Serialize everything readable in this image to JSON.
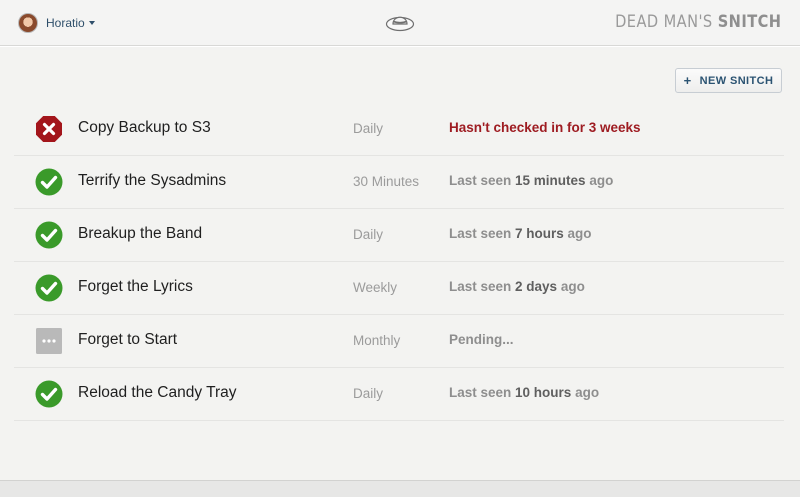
{
  "header": {
    "user_name": "Horatio",
    "brand_light": "DEAD MAN'S ",
    "brand_strong": "SNITCH"
  },
  "actions": {
    "new_snitch_plus": "+",
    "new_snitch_label": "NEW SNITCH"
  },
  "snitches": [
    {
      "name": "Copy Backup to S3",
      "interval": "Daily",
      "status": "failed",
      "seen_prefix": "Hasn't checked in for ",
      "seen_value": "3 weeks",
      "seen_suffix": ""
    },
    {
      "name": "Terrify the Sysadmins",
      "interval": "30 Minutes",
      "status": "ok",
      "seen_prefix": "Last seen ",
      "seen_value": "15 minutes",
      "seen_suffix": " ago"
    },
    {
      "name": "Breakup the Band",
      "interval": "Daily",
      "status": "ok",
      "seen_prefix": "Last seen ",
      "seen_value": "7 hours",
      "seen_suffix": " ago"
    },
    {
      "name": "Forget the Lyrics",
      "interval": "Weekly",
      "status": "ok",
      "seen_prefix": "Last seen ",
      "seen_value": "2 days",
      "seen_suffix": " ago"
    },
    {
      "name": "Forget to Start",
      "interval": "Monthly",
      "status": "pending",
      "seen_prefix": "Pending...",
      "seen_value": "",
      "seen_suffix": ""
    },
    {
      "name": "Reload the Candy Tray",
      "interval": "Daily",
      "status": "ok",
      "seen_prefix": "Last seen ",
      "seen_value": "10 hours",
      "seen_suffix": " ago"
    }
  ],
  "icons": {
    "failed": "x-octagon-icon",
    "ok": "check-circle-icon",
    "pending": "pending-icon",
    "logo": "hat-icon"
  },
  "colors": {
    "ok": "#3a9a2a",
    "failed": "#a3151b",
    "pending": "#b9b9b9",
    "alert_text": "#9e1c22",
    "accent": "#2b5372"
  }
}
